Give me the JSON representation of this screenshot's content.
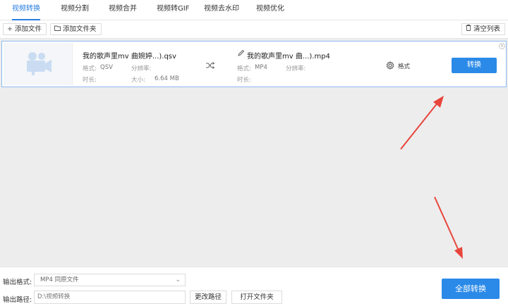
{
  "tabs": [
    {
      "label": "视频转换",
      "active": true
    },
    {
      "label": "视频分割"
    },
    {
      "label": "视频合并"
    },
    {
      "label": "视频转GIF"
    },
    {
      "label": "视频去水印"
    },
    {
      "label": "视频优化"
    }
  ],
  "toolbar": {
    "add_file": "添加文件",
    "add_folder": "添加文件夹",
    "clear_list": "清空列表"
  },
  "file": {
    "source_name": "我的歌声里mv  曲婉婷...).qsv",
    "source_format_label": "格式:",
    "source_format": "QSV",
    "source_resolution_label": "分辨率:",
    "source_duration_label": "时长:",
    "source_size_label": "大小:",
    "source_size": "6.64 MB",
    "output_name": "我的歌声里mv  曲...).mp4",
    "output_format_label": "格式:",
    "output_format": "MP4",
    "output_resolution_label": "分辨率:",
    "output_duration_label": "时长:",
    "format_button": "格式",
    "convert_button": "转换"
  },
  "bottom": {
    "output_format_label": "输出格式:",
    "output_format_value": "MP4  同原文件",
    "output_path_label": "输出路径:",
    "output_path_value": "D:\\视频转换",
    "change_path": "更改路径",
    "open_folder": "打开文件夹",
    "convert_all": "全部转换"
  },
  "colors": {
    "accent": "#2a7fe0",
    "button": "#2b8ae8",
    "arrow": "#e8453c"
  }
}
